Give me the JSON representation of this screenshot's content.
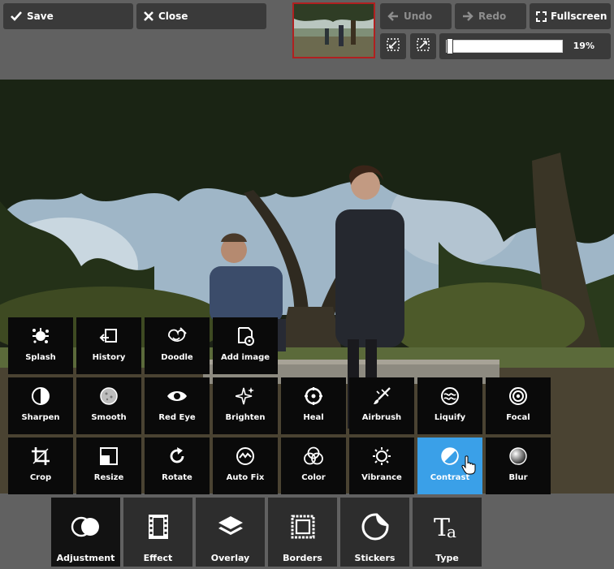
{
  "toolbar": {
    "save_label": "Save",
    "close_label": "Close",
    "undo_label": "Undo",
    "redo_label": "Redo",
    "fullscreen_label": "Fullscreen",
    "zoom_percent": "19%",
    "zoom_level": 0.19
  },
  "tools": {
    "row1": [
      "Splash",
      "History",
      "Doodle",
      "Add image"
    ],
    "row2": [
      "Sharpen",
      "Smooth",
      "Red Eye",
      "Brighten",
      "Heal",
      "Airbrush",
      "Liquify",
      "Focal"
    ],
    "row3": [
      "Crop",
      "Resize",
      "Rotate",
      "Auto Fix",
      "Color",
      "Vibrance",
      "Contrast",
      "Blur"
    ]
  },
  "categories": [
    "Adjustment",
    "Effect",
    "Overlay",
    "Borders",
    "Stickers",
    "Type"
  ],
  "colors": {
    "background": "#616161",
    "button": "#3a3a3a",
    "tool_bg": "#0a0a0a",
    "active_tool": "#3aa0e8",
    "thumbnail_border": "#b02020"
  },
  "icons": {
    "save": "check-icon",
    "close": "x-icon",
    "undo": "arrow-left-icon",
    "redo": "arrow-right-icon",
    "fullscreen": "expand-icon"
  }
}
